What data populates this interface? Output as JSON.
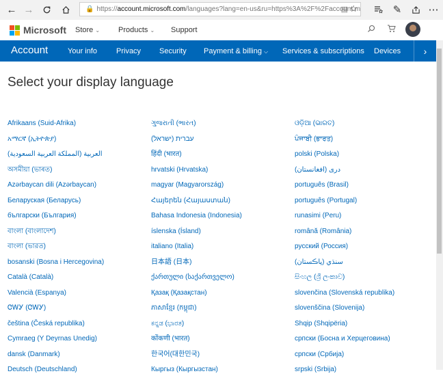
{
  "browser": {
    "url_prefix": "https://",
    "url_domain": "account.microsoft.com",
    "url_rest": "/languages?lang=en-us&ru=https%3A%2F%2Faccount.microsof"
  },
  "header": {
    "brand": "Microsoft",
    "nav": [
      "Store",
      "Products",
      "Support"
    ]
  },
  "account_nav": {
    "title": "Account",
    "items": [
      "Your info",
      "Privacy",
      "Security",
      "Payment & billing",
      "Services & subscriptions",
      "Devices"
    ]
  },
  "page": {
    "title": "Select your display language"
  },
  "languages": {
    "col1": [
      "Afrikaans (Suid-Afrika)",
      "አማርኛ (ኢትዮጵያ)",
      "العربية (المملكة العربية السعودية)",
      "অসমীয়া (ভাৰত)",
      "Azərbaycan dili (Azərbaycan)",
      "Беларуская (Беларусь)",
      "български (България)",
      "বাংলা (বাংলাদেশ)",
      "বাংলা (ভারত)",
      "bosanski (Bosna i Hercegovina)",
      "Català (Català)",
      "Valencià (Espanya)",
      "ᏣᎳᎩ (ᏣᎳᎩ)",
      "čeština (Česká republika)",
      "Cymraeg (Y Deyrnas Unedig)",
      "dansk (Danmark)",
      "Deutsch (Deutschland)"
    ],
    "col2": [
      "ગુજરાતી (ભારત)",
      "עברית (ישראל)",
      "हिंदी (भारत)",
      "hrvatski (Hrvatska)",
      "magyar (Magyarország)",
      "Հայերեն (Հայաստան)",
      "Bahasa Indonesia (Indonesia)",
      "íslenska (Ísland)",
      "italiano (Italia)",
      "日本語 (日本)",
      "ქართული (საქართველო)",
      "Қазақ (Қазақстан)",
      "ភាសាខ្មែរ (កម្ពុជា)",
      "ಕನ್ನಡ (ಭಾರತ)",
      "कोंकणी (भारत)",
      "한국어(대한민국)",
      "Кыргыз (Кыргызстан)"
    ],
    "col3": [
      "ଓଡ଼ିଆ (ଭାରତ)",
      "ਪੰਜਾਬੀ (ਭਾਰਤ)",
      "polski (Polska)",
      "دری (افغانستان)",
      "português (Brasil)",
      "português (Portugal)",
      "runasimi (Peru)",
      "română (România)",
      "русский (Россия)",
      "سنڌي (پاڪستان)",
      "සිංහල (ශ්‍රී ලංකාව)",
      "slovenčina (Slovenská republika)",
      "slovenščina (Slovenija)",
      "Shqip (Shqipëria)",
      "српски (Босна и Херцеговина)",
      "српски (Србија)",
      "srpski (Srbija)"
    ]
  },
  "colors": {
    "accent": "#0067b8",
    "link": "#0067b8"
  }
}
